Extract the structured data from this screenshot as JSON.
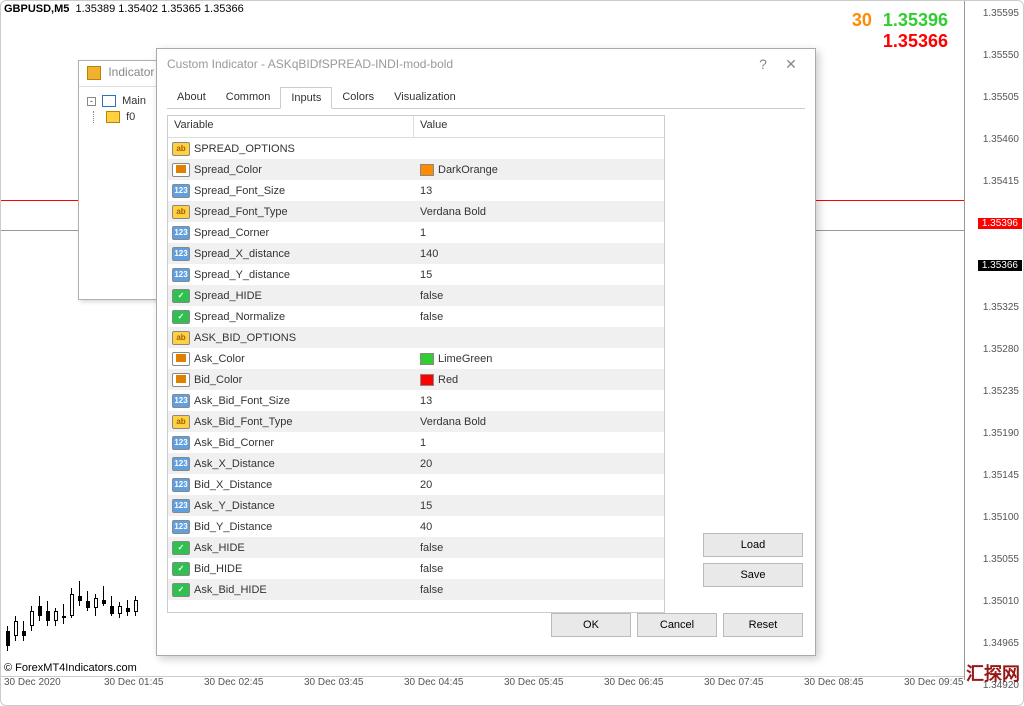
{
  "chart": {
    "symbol": "GBPUSD,M5",
    "quotes": "1.35389 1.35402 1.35365 1.35366",
    "spread": "30",
    "ask": "1.35396",
    "bid": "1.35366",
    "price_axis": [
      "1.35595",
      "1.35550",
      "1.35505",
      "1.35460",
      "1.35415",
      "1.35396",
      "1.35366",
      "1.35325",
      "1.35280",
      "1.35235",
      "1.35190",
      "1.35145",
      "1.35100",
      "1.35055",
      "1.35010",
      "1.34965",
      "1.34920"
    ],
    "time_axis": [
      "30 Dec 2020",
      "30 Dec 01:45",
      "30 Dec 02:45",
      "30 Dec 03:45",
      "30 Dec 04:45",
      "30 Dec 05:45",
      "30 Dec 06:45",
      "30 Dec 07:45",
      "30 Dec 08:45",
      "30 Dec 09:45"
    ],
    "attribution": "© ForexMT4Indicators.com",
    "watermark": "汇探网"
  },
  "small_window": {
    "title": "Indicator",
    "main_label": "Main",
    "fn_prefix": "f0"
  },
  "dialog": {
    "title": "Custom Indicator - ASKqBIDfSPREAD-INDI-mod-bold",
    "tabs": [
      "About",
      "Common",
      "Inputs",
      "Colors",
      "Visualization"
    ],
    "active_tab": "Inputs",
    "col_var": "Variable",
    "col_val": "Value",
    "load": "Load",
    "save": "Save",
    "ok": "OK",
    "cancel": "Cancel",
    "reset": "Reset",
    "rows": [
      {
        "type": "str",
        "name": "SPREAD_OPTIONS",
        "value": ""
      },
      {
        "type": "color",
        "name": "Spread_Color",
        "value": "DarkOrange",
        "hex": "#ff8c00"
      },
      {
        "type": "int",
        "name": "Spread_Font_Size",
        "value": "13"
      },
      {
        "type": "str",
        "name": "Spread_Font_Type",
        "value": "Verdana Bold"
      },
      {
        "type": "int",
        "name": "Spread_Corner",
        "value": "1"
      },
      {
        "type": "int",
        "name": "Spread_X_distance",
        "value": "140"
      },
      {
        "type": "int",
        "name": "Spread_Y_distance",
        "value": "15"
      },
      {
        "type": "bool",
        "name": "Spread_HIDE",
        "value": "false"
      },
      {
        "type": "bool",
        "name": "Spread_Normalize",
        "value": "false"
      },
      {
        "type": "str",
        "name": "ASK_BID_OPTIONS",
        "value": ""
      },
      {
        "type": "color",
        "name": "Ask_Color",
        "value": "LimeGreen",
        "hex": "#32cd32"
      },
      {
        "type": "color",
        "name": "Bid_Color",
        "value": "Red",
        "hex": "#ff0000"
      },
      {
        "type": "int",
        "name": "Ask_Bid_Font_Size",
        "value": "13"
      },
      {
        "type": "str",
        "name": "Ask_Bid_Font_Type",
        "value": "Verdana Bold"
      },
      {
        "type": "int",
        "name": "Ask_Bid_Corner",
        "value": "1"
      },
      {
        "type": "int",
        "name": "Ask_X_Distance",
        "value": "20"
      },
      {
        "type": "int",
        "name": "Bid_X_Distance",
        "value": "20"
      },
      {
        "type": "int",
        "name": "Ask_Y_Distance",
        "value": "15"
      },
      {
        "type": "int",
        "name": "Bid_Y_Distance",
        "value": "40"
      },
      {
        "type": "bool",
        "name": "Ask_HIDE",
        "value": "false"
      },
      {
        "type": "bool",
        "name": "Bid_HIDE",
        "value": "false"
      },
      {
        "type": "bool",
        "name": "Ask_Bid_HIDE",
        "value": "false"
      }
    ]
  }
}
